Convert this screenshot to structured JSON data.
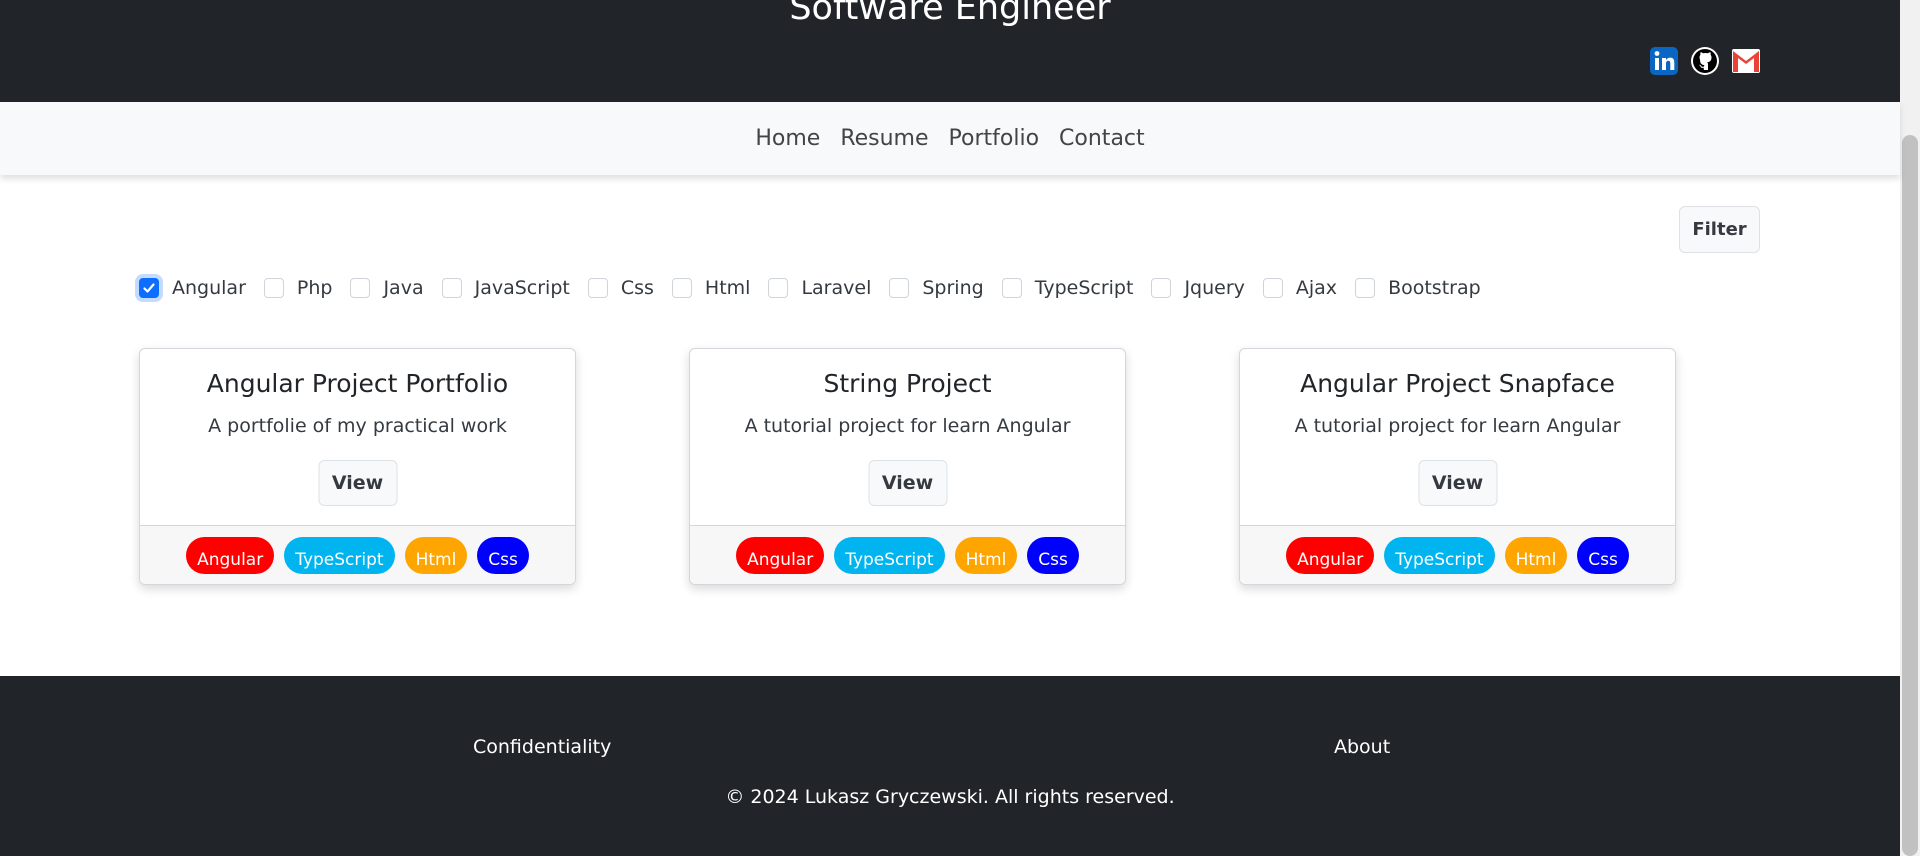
{
  "header": {
    "title": "Software Engineer",
    "socials": [
      {
        "icon": "linkedin-icon",
        "color": "#0a66c2"
      },
      {
        "icon": "github-icon",
        "color": "#ffffff"
      },
      {
        "icon": "gmail-icon",
        "color": "#ea4335"
      }
    ]
  },
  "nav": {
    "items": [
      "Home",
      "Resume",
      "Portfolio",
      "Contact"
    ]
  },
  "filter": {
    "button_label": "Filter",
    "options": [
      {
        "label": "Angular",
        "checked": true
      },
      {
        "label": "Php",
        "checked": false
      },
      {
        "label": "Java",
        "checked": false
      },
      {
        "label": "JavaScript",
        "checked": false
      },
      {
        "label": "Css",
        "checked": false
      },
      {
        "label": "Html",
        "checked": false
      },
      {
        "label": "Laravel",
        "checked": false
      },
      {
        "label": "Spring",
        "checked": false
      },
      {
        "label": "TypeScript",
        "checked": false
      },
      {
        "label": "Jquery",
        "checked": false
      },
      {
        "label": "Ajax",
        "checked": false
      },
      {
        "label": "Bootstrap",
        "checked": false
      }
    ]
  },
  "projects": [
    {
      "title": "Angular Project Portfolio",
      "description": "A portfolie of my practical work",
      "button_label": "View",
      "tags": [
        "Angular",
        "TypeScript",
        "Html",
        "Css"
      ]
    },
    {
      "title": "String Project",
      "description": "A tutorial project for learn Angular",
      "button_label": "View",
      "tags": [
        "Angular",
        "TypeScript",
        "Html",
        "Css"
      ]
    },
    {
      "title": "Angular Project Snapface",
      "description": "A tutorial project for learn Angular",
      "button_label": "View",
      "tags": [
        "Angular",
        "TypeScript",
        "Html",
        "Css"
      ]
    }
  ],
  "tag_colors": {
    "Angular": "#ff0000",
    "TypeScript": "#00b4f0",
    "Html": "#ffa500",
    "Css": "#0000ff"
  },
  "footer": {
    "left_link": "Confidentiality",
    "right_link": "About",
    "copyright": "© 2024 Lukasz Gryczewski. All rights reserved."
  },
  "colors": {
    "dark": "#212529",
    "checkbox_accent": "#0d6efd"
  }
}
